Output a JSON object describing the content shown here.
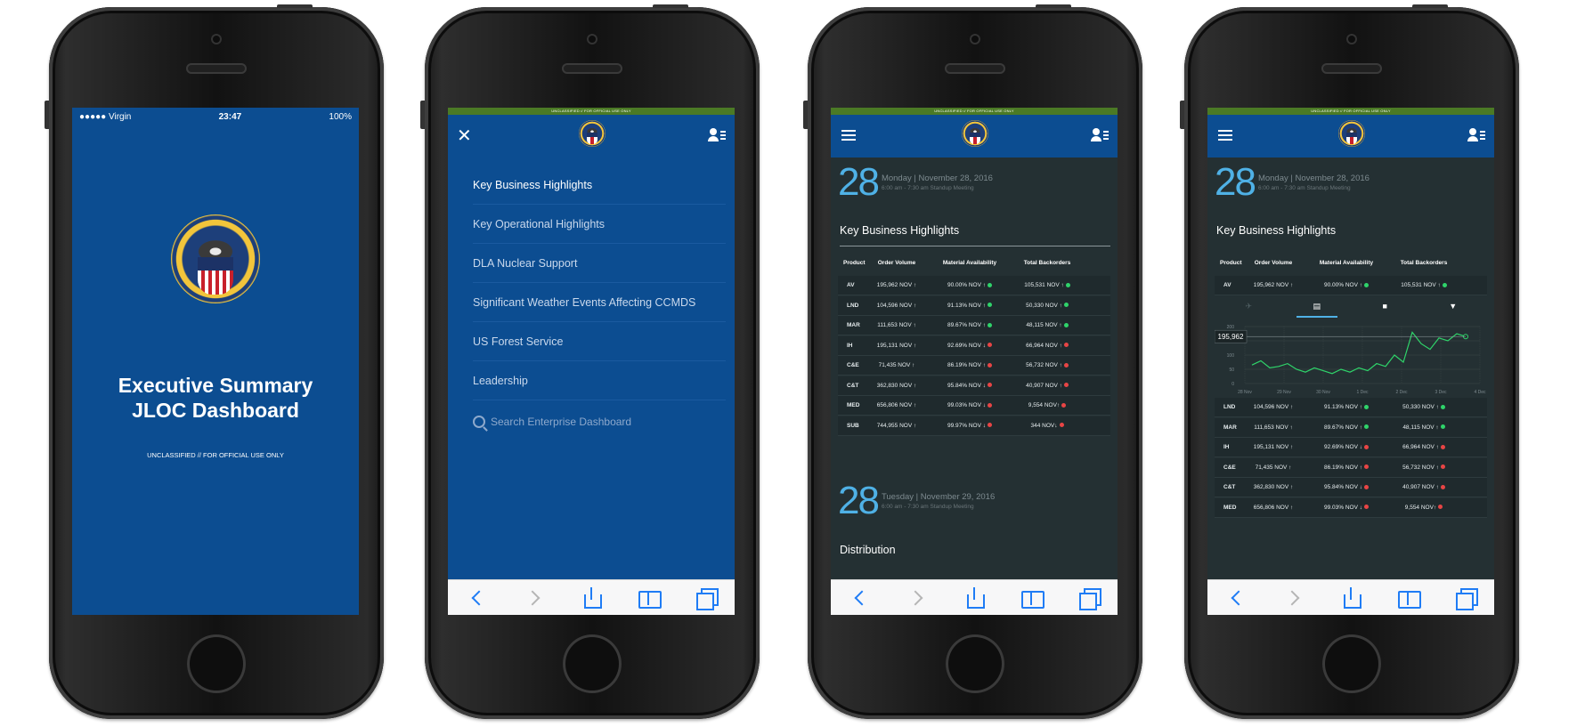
{
  "screen1": {
    "status": {
      "carrier": "●●●●● Virgin",
      "time": "23:47",
      "battery": "100%"
    },
    "title_line1": "Executive Summary",
    "title_line2": "JLOC Dashboard",
    "classification": "UNCLASSIFIED // FOR OFFICIAL USE ONLY"
  },
  "banner": {
    "text": "UNCLASSIFIED // FOR OFFICIAL USE ONLY"
  },
  "menu": {
    "items": [
      {
        "label": "Key Business Highlights"
      },
      {
        "label": "Key Operational Highlights"
      },
      {
        "label": "DLA Nuclear Support"
      },
      {
        "label": "Significant Weather  Events Affecting CCMDS"
      },
      {
        "label": "US Forest Service"
      },
      {
        "label": "Leadership"
      }
    ],
    "search_placeholder": "Search Enterprise Dashboard"
  },
  "dashboard": {
    "day1": {
      "num": "28",
      "date": "Monday | November  28, 2016",
      "time": "6:00 am - 7:30 am Standup Meeting"
    },
    "day2": {
      "num": "28",
      "date": "Tuesday | November  29, 2016",
      "time": "6:00 am - 7:30 am Standup Meeting"
    },
    "section1": "Key Business Highlights",
    "section2": "Distribution",
    "headers": [
      "Product",
      "Order Volume",
      "Material Availability",
      "Total Backorders"
    ],
    "rows": [
      {
        "product": "AV",
        "volume": "195,962 NOV ↑",
        "avail": "90.00% NOV ↑",
        "avail_status": "g",
        "back": "105,531 NOV ↑",
        "back_status": "g"
      },
      {
        "product": "LND",
        "volume": "104,596 NOV ↑",
        "avail": "91.13% NOV ↑",
        "avail_status": "g",
        "back": "50,330 NOV ↑",
        "back_status": "g"
      },
      {
        "product": "MAR",
        "volume": "111,653 NOV ↑",
        "avail": "89.67% NOV ↑",
        "avail_status": "g",
        "back": "48,115 NOV ↑",
        "back_status": "g"
      },
      {
        "product": "IH",
        "volume": "195,131 NOV ↑",
        "avail": "92.69% NOV ↓",
        "avail_status": "r",
        "back": "66,964 NOV ↑",
        "back_status": "r"
      },
      {
        "product": "C&E",
        "volume": "71,435 NOV ↑",
        "avail": "86.19% NOV ↑",
        "avail_status": "r",
        "back": "56,732 NOV ↑",
        "back_status": "r"
      },
      {
        "product": "C&T",
        "volume": "362,830 NOV ↑",
        "avail": "95.84% NOV ↓",
        "avail_status": "r",
        "back": "40,907 NOV ↑",
        "back_status": "r"
      },
      {
        "product": "MED",
        "volume": "656,806 NOV ↑",
        "avail": "99.03% NOV ↓",
        "avail_status": "r",
        "back": "9,554 NOV↑",
        "back_status": "r"
      },
      {
        "product": "SUB",
        "volume": "744,955 NOV ↑",
        "avail": "99.97% NOV ↓",
        "avail_status": "r",
        "back": "344 NOV↓",
        "back_status": "r"
      }
    ]
  },
  "chart_data": {
    "type": "line",
    "x": [
      "28 Nov",
      "29 Nov",
      "30 Nov",
      "1 Dec",
      "2 Dec",
      "3 Dec",
      "4 Dec"
    ],
    "ylim": [
      0,
      200
    ],
    "yticks": [
      "0",
      "50",
      "100",
      "150",
      "200"
    ],
    "highlight_label": "195,962",
    "series": [
      {
        "values": [
          65,
          80,
          55,
          60,
          70,
          50,
          40,
          55,
          45,
          35,
          50,
          40,
          55,
          45,
          70,
          60,
          100,
          75,
          180,
          140,
          120,
          160,
          150,
          175,
          165
        ]
      }
    ],
    "color": "#2fd46a",
    "tab_icons": [
      "plane-icon",
      "document-icon",
      "truck-icon",
      "cart-icon"
    ]
  },
  "colors": {
    "blue": "#0c4d91",
    "green_banner": "#4b7a25",
    "dark_bg": "#243033",
    "accent": "#4fb1e6",
    "ios_blue": "#1f7cf5"
  }
}
